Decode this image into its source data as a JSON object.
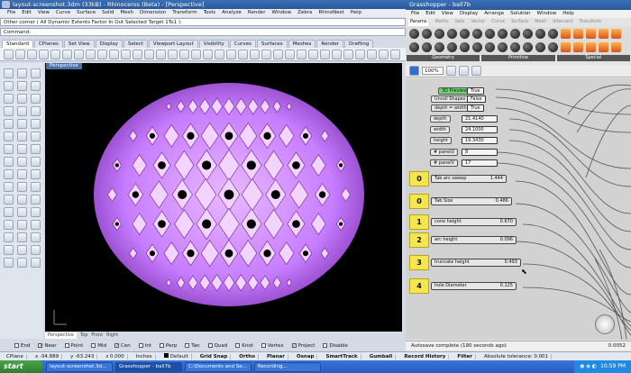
{
  "rhino": {
    "title": "layout-screenshot.3dm (33kB) - Rhinoceros (Beta) - [Perspective]",
    "menu": [
      "File",
      "Edit",
      "View",
      "Curve",
      "Surface",
      "Solid",
      "Mesh",
      "Dimension",
      "Transform",
      "Tools",
      "Analyze",
      "Render",
      "Window",
      "Zebra",
      "RhinoNest",
      "Help"
    ],
    "command_history": "Other corner ( All Dynamic Extents Factor In Out Selected Target 1To1 ):",
    "command_prompt": "Command:",
    "toolbar_tabs": [
      "Standard",
      "CPlanes",
      "Set View",
      "Display",
      "Select",
      "Viewport Layout",
      "Visibility",
      "Curves",
      "Surfaces",
      "Meshes",
      "Render",
      "Drafting"
    ],
    "viewport_label": "Perspective",
    "view_tabs": [
      "Perspective",
      "Top",
      "Front",
      "Right"
    ],
    "osnaps": [
      {
        "label": "End",
        "on": false
      },
      {
        "label": "Near",
        "on": true
      },
      {
        "label": "Point",
        "on": false
      },
      {
        "label": "Mid",
        "on": false
      },
      {
        "label": "Cen",
        "on": true
      },
      {
        "label": "Int",
        "on": false
      },
      {
        "label": "Perp",
        "on": false
      },
      {
        "label": "Tan",
        "on": false
      },
      {
        "label": "Quad",
        "on": false
      },
      {
        "label": "Knot",
        "on": false
      },
      {
        "label": "Vertex",
        "on": false
      },
      {
        "label": "Project",
        "on": true
      },
      {
        "label": "Disable",
        "on": false
      }
    ],
    "status": {
      "cplane": "CPlane",
      "x": "x -34.889",
      "y": "y -63.243",
      "z": "z 0.000",
      "units": "Inches",
      "layer": "Default",
      "buttons": [
        "Grid Snap",
        "Ortho",
        "Planar",
        "Osnap",
        "SmartTrack",
        "Gumball",
        "Record History",
        "Filter"
      ],
      "tolerance": "Absolute tolerance: 0.001"
    }
  },
  "grasshopper": {
    "title": "Grasshopper - ball7b",
    "menu": [
      "File",
      "Edit",
      "View",
      "Display",
      "Arrange",
      "Solution",
      "Window",
      "Help"
    ],
    "doc_name": "ball7b",
    "tabs": [
      "Params",
      "Maths",
      "Sets",
      "Vector",
      "Curve",
      "Surface",
      "Mesh",
      "Intersect",
      "Transform"
    ],
    "ribbon_groups": [
      "Geometry",
      "Primitive",
      "Special"
    ],
    "zoom": "100%",
    "params": [
      {
        "name": "3D Preview",
        "value": "True"
      },
      {
        "name": "Unroll Shapes",
        "value": "False"
      },
      {
        "name": "depth = width",
        "value": "True"
      },
      {
        "name": "depth",
        "value": "21.4140"
      },
      {
        "name": "width",
        "value": "24.1000"
      },
      {
        "name": "height",
        "value": "19.3430"
      },
      {
        "name": "# panelU",
        "value": "8"
      },
      {
        "name": "# panelV",
        "value": "17"
      }
    ],
    "sliders": [
      {
        "panel": "0",
        "name": "Tab arc sweep",
        "value": "1.444"
      },
      {
        "panel": "0",
        "name": "Tab Size",
        "value": "0.486"
      },
      {
        "panel": "1",
        "name": "cone height",
        "value": "0.670"
      },
      {
        "panel": "2",
        "name": "arc height",
        "value": "0.096"
      },
      {
        "panel": "3",
        "name": "truncate height",
        "value": "0.493"
      },
      {
        "panel": "4",
        "name": "hole Diameter",
        "value": "0.125"
      }
    ],
    "status_left": "Autosave complete (190 seconds ago)",
    "status_right": "0.0052"
  },
  "taskbar": {
    "start": "start",
    "tasks": [
      "layout-screenshot.3d...",
      "Grasshopper - ball7b",
      "C:\\Documents and Se...",
      "Recording..."
    ],
    "clock": "10:59 PM"
  },
  "colors": {
    "shape": "#c77dff",
    "shape_shadow": "#7b2aa8",
    "viewport_bg": "#000000",
    "slider_panel": "#f5e64f"
  }
}
